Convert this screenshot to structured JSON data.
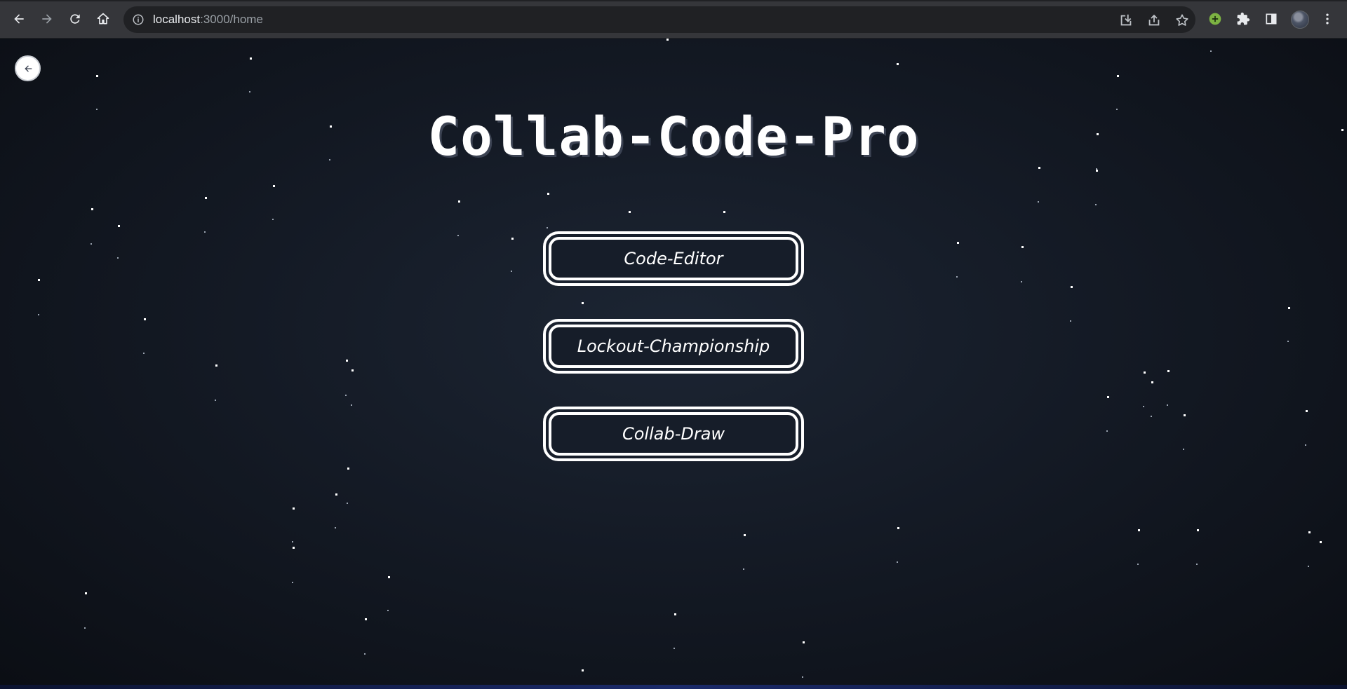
{
  "browser": {
    "url_host": "localhost",
    "url_path": ":3000/home",
    "icons": {
      "back": "arrow-left-icon",
      "forward": "arrow-right-icon",
      "reload": "reload-icon",
      "home": "home-icon",
      "info": "info-icon",
      "install": "install-icon",
      "share": "share-icon",
      "bookmark": "star-icon",
      "extension_green": "plus-circle-icon",
      "extensions": "puzzle-icon",
      "side_panel": "side-panel-icon",
      "menu": "kebab-menu-icon"
    }
  },
  "page": {
    "back_icon": "arrow-left-icon",
    "title": "Collab-Code-Pro",
    "buttons": [
      {
        "label": "Code-Editor"
      },
      {
        "label": "Lockout-Championship"
      },
      {
        "label": "Collab-Draw"
      }
    ]
  },
  "colors": {
    "background": "#141a25",
    "button_border": "#ffffff",
    "text": "#ffffff",
    "extension_accent": "#7cb342"
  }
}
